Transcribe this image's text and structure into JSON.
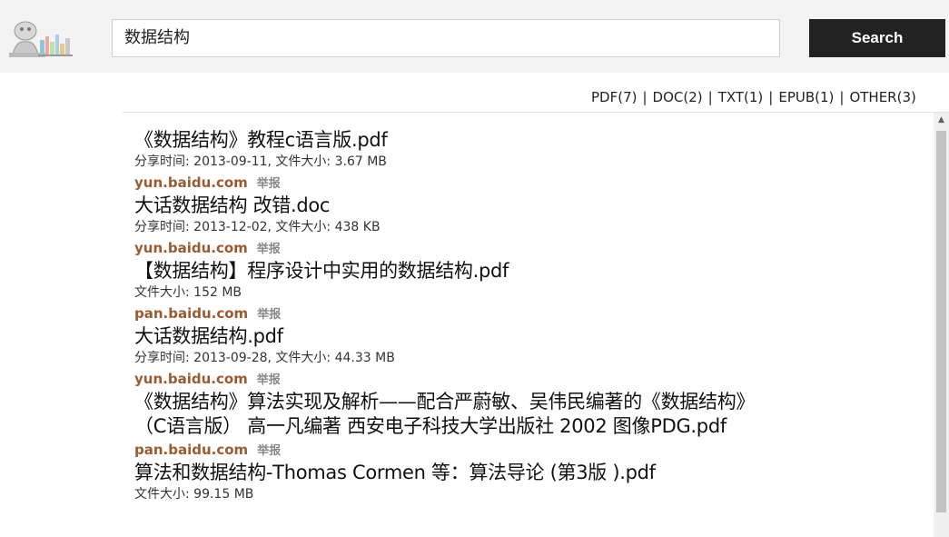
{
  "search": {
    "query": "数据结构",
    "button_label": "Search"
  },
  "filters": [
    {
      "label": "PDF(7)"
    },
    {
      "label": "DOC(2)"
    },
    {
      "label": "TXT(1)"
    },
    {
      "label": "EPUB(1)"
    },
    {
      "label": "OTHER(3)"
    }
  ],
  "filter_separator": "|",
  "results": [
    {
      "title": "《数据结构》教程c语言版.pdf",
      "meta": "分享时间: 2013-09-11, 文件大小: 3.67 MB",
      "source": "yun.baidu.com",
      "report": "举报"
    },
    {
      "title": "大话数据结构 改错.doc",
      "meta": "分享时间: 2013-12-02, 文件大小: 438 KB",
      "source": "yun.baidu.com",
      "report": "举报"
    },
    {
      "title": "【数据结构】程序设计中实用的数据结构.pdf",
      "meta": "文件大小: 152 MB",
      "source": "pan.baidu.com",
      "report": "举报"
    },
    {
      "title": "大话数据结构.pdf",
      "meta": "分享时间: 2013-09-28, 文件大小: 44.33 MB",
      "source": "yun.baidu.com",
      "report": "举报"
    },
    {
      "title": "《数据结构》算法实现及解析——配合严蔚敏、吴伟民编著的《数据结构》（C语言版） 高一凡编著 西安电子科技大学出版社 2002 图像PDG.pdf",
      "meta": "",
      "source": "pan.baidu.com",
      "report": "举报"
    },
    {
      "title": "算法和数据结构-Thomas Cormen 等：算法导论 (第3版 ).pdf",
      "meta": "文件大小: 99.15 MB",
      "source": "",
      "report": ""
    }
  ],
  "colors": {
    "header_bg": "#f3f3f3",
    "button_bg": "#222222",
    "source_link": "#9a5b30",
    "report_link": "#888888"
  },
  "icons": {
    "logo": "bookshelf-logo-icon",
    "scroll_up": "triangle-up-icon"
  }
}
